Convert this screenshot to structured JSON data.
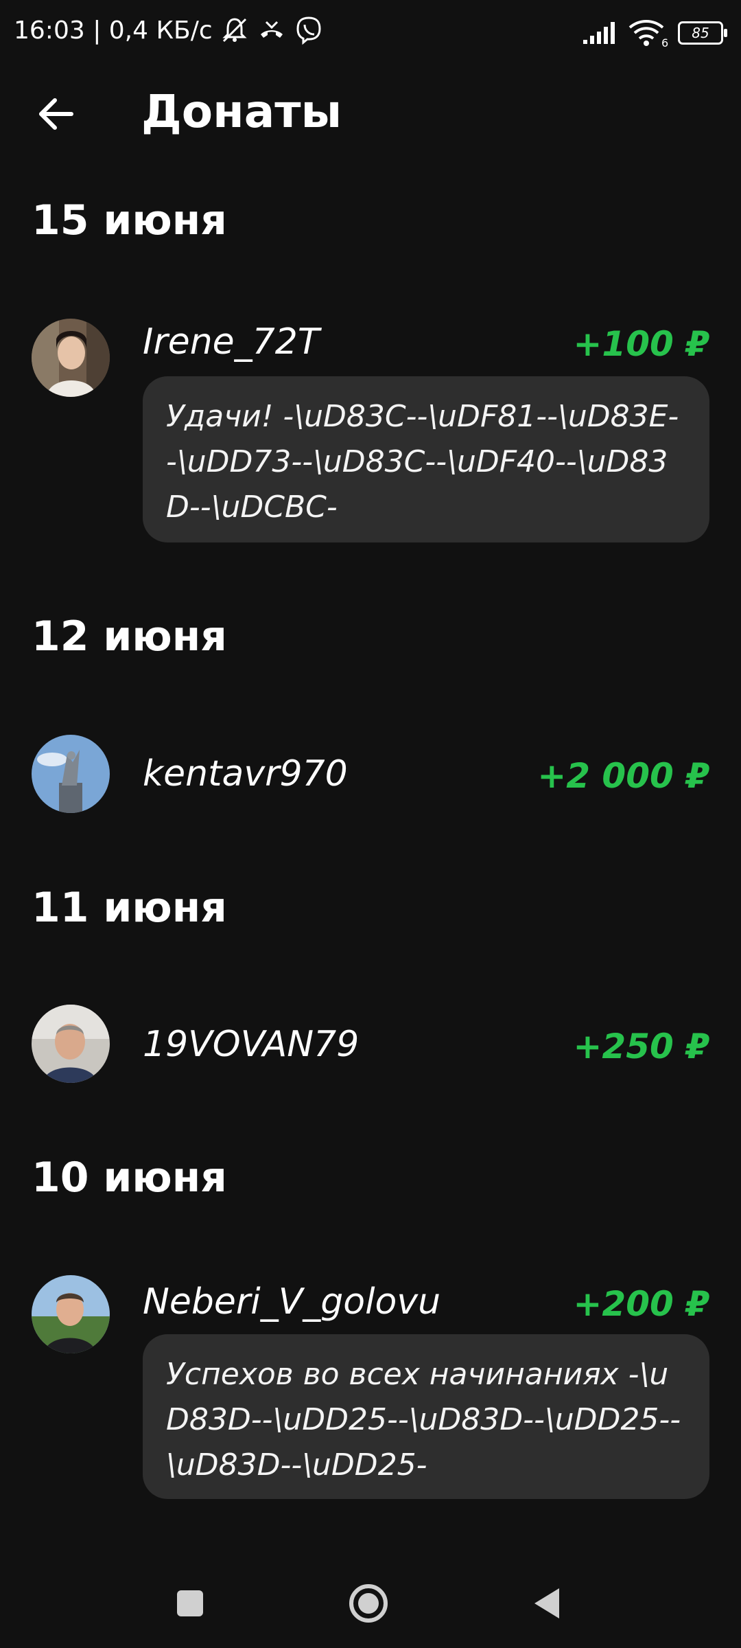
{
  "status_bar": {
    "time_speed": "16:03 | 0,4 КБ/с",
    "battery": "85",
    "wifi_label": "6"
  },
  "header": {
    "title": "Донаты"
  },
  "groups": [
    {
      "date": "15 июня",
      "donor": "Irene_72T",
      "amount": "+100 ₽",
      "message": "Удачи! -\\uD83C--\\uDF81--\\uD83E--\\uDD73--\\uD83C--\\uDF40--\\uD83D--\\uDCBC-"
    },
    {
      "date": "12 июня",
      "donor": "kentavr970",
      "amount": "+2 000 ₽"
    },
    {
      "date": "11 июня",
      "donor": "19VOVAN79",
      "amount": "+250 ₽"
    },
    {
      "date": "10 июня",
      "donor": "Neberi_V_golovu",
      "amount": "+200 ₽",
      "message": "Успехов во всех начинаниях -\\uD83D--\\uDD25--\\uD83D--\\uDD25--\\uD83D--\\uDD25-"
    }
  ],
  "icons": {
    "back": "arrow-left-icon",
    "recents": "square-icon",
    "home": "circle-icon",
    "nav_back": "triangle-back-icon"
  },
  "colors": {
    "background": "#111111",
    "bubble": "#2e2e2e",
    "amount": "#27c24c"
  }
}
